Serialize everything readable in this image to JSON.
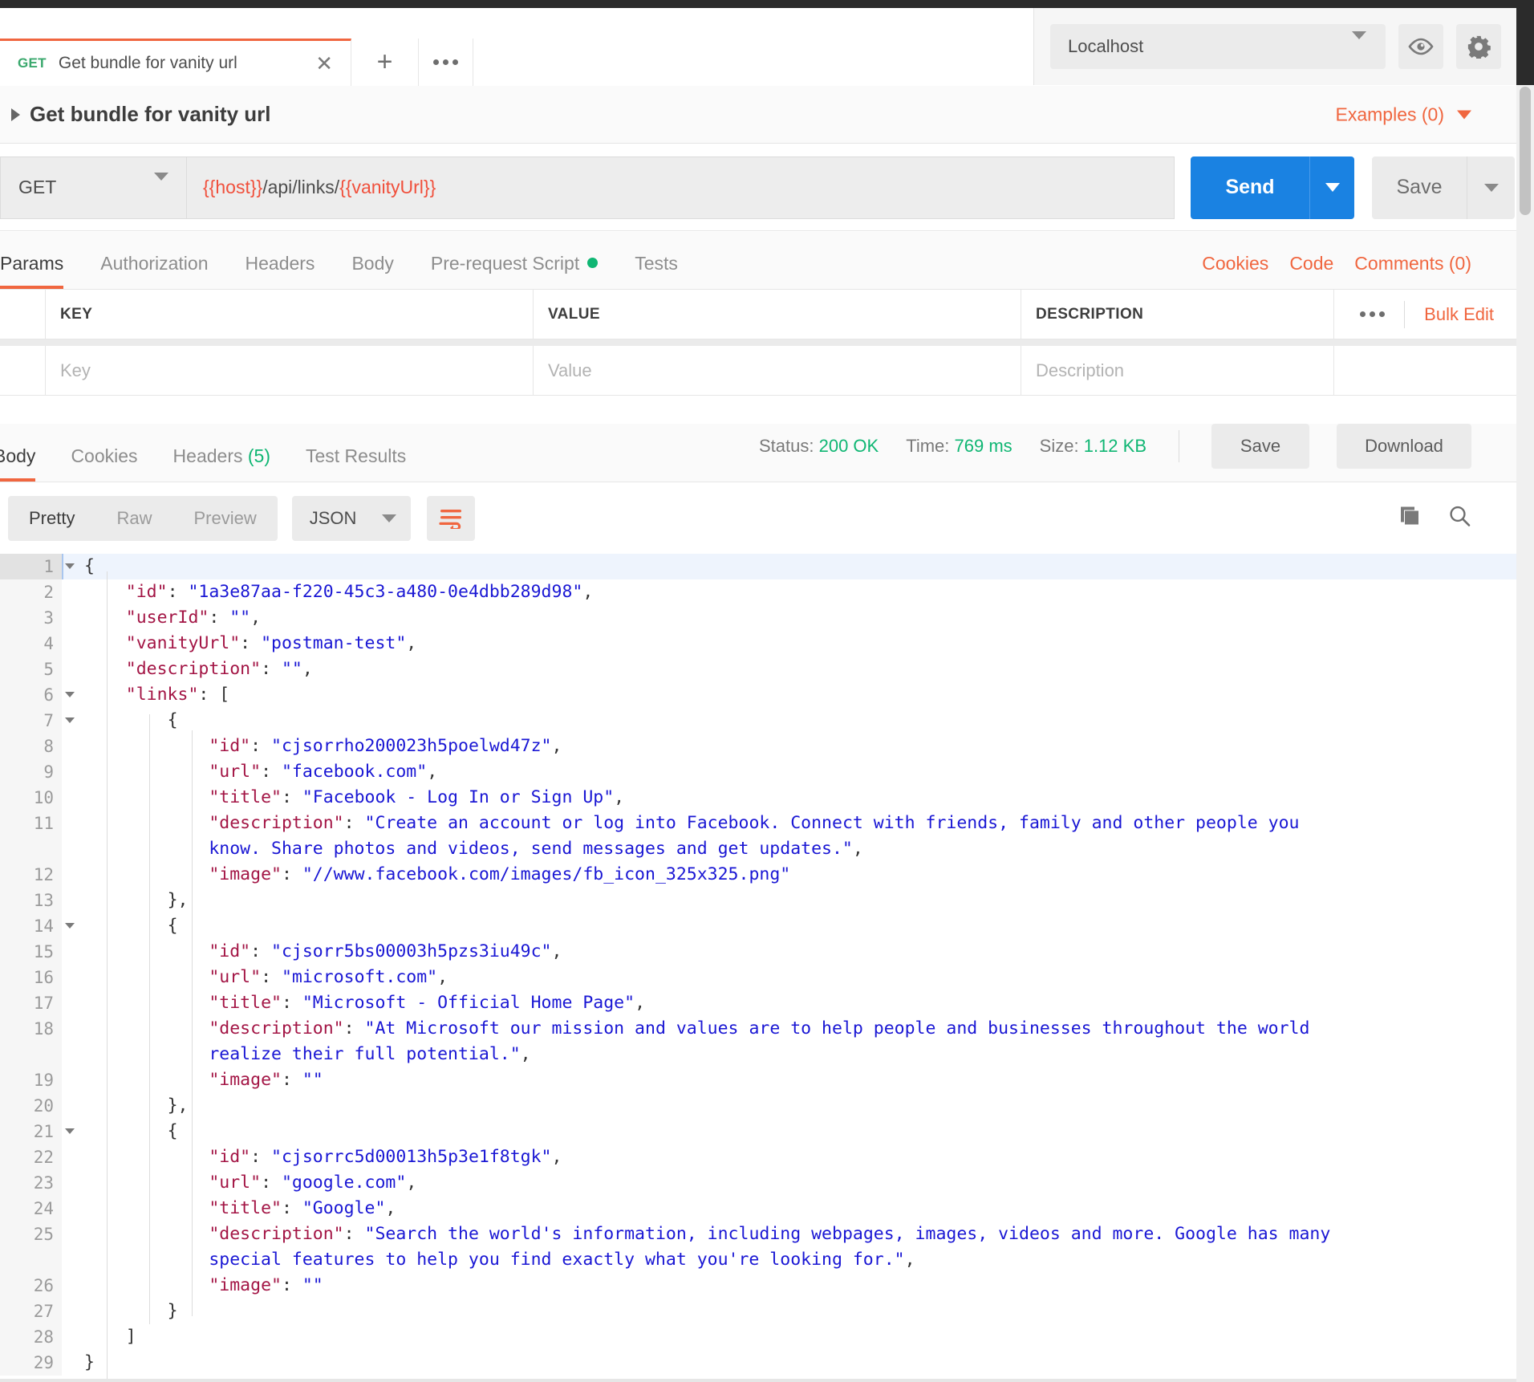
{
  "window": {
    "tab": {
      "method": "GET",
      "title": "Get bundle for vanity url",
      "close_icon": "close-icon",
      "new_tab_icon": "plus-icon",
      "more_icon": "ellipsis-icon"
    },
    "environment": {
      "selected": "Localhost",
      "eye_icon": "eye-icon",
      "gear_icon": "gear-icon"
    }
  },
  "request": {
    "title": "Get bundle for vanity url",
    "examples_label": "Examples (0)",
    "method": "GET",
    "url_parts": [
      {
        "text": "{{host}}",
        "type": "variable"
      },
      {
        "text": "/api/links/",
        "type": "plain"
      },
      {
        "text": "{{vanityUrl}}",
        "type": "variable"
      }
    ],
    "url_full": "{{host}}/api/links/{{vanityUrl}}",
    "send_label": "Send",
    "save_label": "Save",
    "tabs": [
      {
        "label": "Params",
        "active": true,
        "dot": false
      },
      {
        "label": "Authorization",
        "active": false,
        "dot": false
      },
      {
        "label": "Headers",
        "active": false,
        "dot": false
      },
      {
        "label": "Body",
        "active": false,
        "dot": false
      },
      {
        "label": "Pre-request Script",
        "active": false,
        "dot": true
      },
      {
        "label": "Tests",
        "active": false,
        "dot": false
      }
    ],
    "right_links": [
      "Cookies",
      "Code",
      "Comments (0)"
    ]
  },
  "params_table": {
    "headers": [
      "KEY",
      "VALUE",
      "DESCRIPTION"
    ],
    "bulk_edit_label": "Bulk Edit",
    "more_icon": "ellipsis-icon",
    "placeholders": [
      "Key",
      "Value",
      "Description"
    ]
  },
  "response": {
    "tabs": [
      {
        "label": "Body",
        "active": true
      },
      {
        "label": "Cookies",
        "active": false
      },
      {
        "label": "Headers",
        "count": "(5)",
        "active": false
      },
      {
        "label": "Test Results",
        "active": false
      }
    ],
    "status_label": "Status:",
    "status_value": "200 OK",
    "time_label": "Time:",
    "time_value": "769 ms",
    "size_label": "Size:",
    "size_value": "1.12 KB",
    "save_label": "Save",
    "download_label": "Download",
    "view_modes": [
      {
        "label": "Pretty",
        "active": true
      },
      {
        "label": "Raw",
        "active": false
      },
      {
        "label": "Preview",
        "active": false
      }
    ],
    "format": "JSON",
    "wrap_icon": "wrap-lines-icon",
    "copy_icon": "copy-icon",
    "search_icon": "search-icon"
  },
  "body_lines": [
    {
      "n": "1",
      "fold": true,
      "highlight": true,
      "indent": 0,
      "tokens": [
        {
          "t": "{",
          "c": "p"
        }
      ]
    },
    {
      "n": "2",
      "fold": false,
      "highlight": false,
      "indent": 1,
      "tokens": [
        {
          "t": "\"id\"",
          "c": "k"
        },
        {
          "t": ": ",
          "c": "p"
        },
        {
          "t": "\"1a3e87aa-f220-45c3-a480-0e4dbb289d98\"",
          "c": "s"
        },
        {
          "t": ",",
          "c": "p"
        }
      ]
    },
    {
      "n": "3",
      "fold": false,
      "highlight": false,
      "indent": 1,
      "tokens": [
        {
          "t": "\"userId\"",
          "c": "k"
        },
        {
          "t": ": ",
          "c": "p"
        },
        {
          "t": "\"\"",
          "c": "s"
        },
        {
          "t": ",",
          "c": "p"
        }
      ]
    },
    {
      "n": "4",
      "fold": false,
      "highlight": false,
      "indent": 1,
      "tokens": [
        {
          "t": "\"vanityUrl\"",
          "c": "k"
        },
        {
          "t": ": ",
          "c": "p"
        },
        {
          "t": "\"postman-test\"",
          "c": "s"
        },
        {
          "t": ",",
          "c": "p"
        }
      ]
    },
    {
      "n": "5",
      "fold": false,
      "highlight": false,
      "indent": 1,
      "tokens": [
        {
          "t": "\"description\"",
          "c": "k"
        },
        {
          "t": ": ",
          "c": "p"
        },
        {
          "t": "\"\"",
          "c": "s"
        },
        {
          "t": ",",
          "c": "p"
        }
      ]
    },
    {
      "n": "6",
      "fold": true,
      "highlight": false,
      "indent": 1,
      "tokens": [
        {
          "t": "\"links\"",
          "c": "k"
        },
        {
          "t": ": [",
          "c": "p"
        }
      ]
    },
    {
      "n": "7",
      "fold": true,
      "highlight": false,
      "indent": 2,
      "tokens": [
        {
          "t": "{",
          "c": "p"
        }
      ]
    },
    {
      "n": "8",
      "fold": false,
      "highlight": false,
      "indent": 3,
      "tokens": [
        {
          "t": "\"id\"",
          "c": "k"
        },
        {
          "t": ": ",
          "c": "p"
        },
        {
          "t": "\"cjsorrho200023h5poelwd47z\"",
          "c": "s"
        },
        {
          "t": ",",
          "c": "p"
        }
      ]
    },
    {
      "n": "9",
      "fold": false,
      "highlight": false,
      "indent": 3,
      "tokens": [
        {
          "t": "\"url\"",
          "c": "k"
        },
        {
          "t": ": ",
          "c": "p"
        },
        {
          "t": "\"facebook.com\"",
          "c": "s"
        },
        {
          "t": ",",
          "c": "p"
        }
      ]
    },
    {
      "n": "10",
      "fold": false,
      "highlight": false,
      "indent": 3,
      "tokens": [
        {
          "t": "\"title\"",
          "c": "k"
        },
        {
          "t": ": ",
          "c": "p"
        },
        {
          "t": "\"Facebook - Log In or Sign Up\"",
          "c": "s"
        },
        {
          "t": ",",
          "c": "p"
        }
      ]
    },
    {
      "n": "11",
      "fold": false,
      "highlight": false,
      "indent": 3,
      "tokens": [
        {
          "t": "\"description\"",
          "c": "k"
        },
        {
          "t": ": ",
          "c": "p"
        },
        {
          "t": "\"Create an account or log into Facebook. Connect with friends, family and other people you\n            know. Share photos and videos, send messages and get updates.\"",
          "c": "s"
        },
        {
          "t": ",",
          "c": "p"
        }
      ]
    },
    {
      "n": "12",
      "fold": false,
      "highlight": false,
      "indent": 3,
      "tokens": [
        {
          "t": "\"image\"",
          "c": "k"
        },
        {
          "t": ": ",
          "c": "p"
        },
        {
          "t": "\"//www.facebook.com/images/fb_icon_325x325.png\"",
          "c": "s"
        }
      ]
    },
    {
      "n": "13",
      "fold": false,
      "highlight": false,
      "indent": 2,
      "tokens": [
        {
          "t": "},",
          "c": "p"
        }
      ]
    },
    {
      "n": "14",
      "fold": true,
      "highlight": false,
      "indent": 2,
      "tokens": [
        {
          "t": "{",
          "c": "p"
        }
      ]
    },
    {
      "n": "15",
      "fold": false,
      "highlight": false,
      "indent": 3,
      "tokens": [
        {
          "t": "\"id\"",
          "c": "k"
        },
        {
          "t": ": ",
          "c": "p"
        },
        {
          "t": "\"cjsorr5bs00003h5pzs3iu49c\"",
          "c": "s"
        },
        {
          "t": ",",
          "c": "p"
        }
      ]
    },
    {
      "n": "16",
      "fold": false,
      "highlight": false,
      "indent": 3,
      "tokens": [
        {
          "t": "\"url\"",
          "c": "k"
        },
        {
          "t": ": ",
          "c": "p"
        },
        {
          "t": "\"microsoft.com\"",
          "c": "s"
        },
        {
          "t": ",",
          "c": "p"
        }
      ]
    },
    {
      "n": "17",
      "fold": false,
      "highlight": false,
      "indent": 3,
      "tokens": [
        {
          "t": "\"title\"",
          "c": "k"
        },
        {
          "t": ": ",
          "c": "p"
        },
        {
          "t": "\"Microsoft - Official Home Page\"",
          "c": "s"
        },
        {
          "t": ",",
          "c": "p"
        }
      ]
    },
    {
      "n": "18",
      "fold": false,
      "highlight": false,
      "indent": 3,
      "tokens": [
        {
          "t": "\"description\"",
          "c": "k"
        },
        {
          "t": ": ",
          "c": "p"
        },
        {
          "t": "\"At Microsoft our mission and values are to help people and businesses throughout the world\n            realize their full potential.\"",
          "c": "s"
        },
        {
          "t": ",",
          "c": "p"
        }
      ]
    },
    {
      "n": "19",
      "fold": false,
      "highlight": false,
      "indent": 3,
      "tokens": [
        {
          "t": "\"image\"",
          "c": "k"
        },
        {
          "t": ": ",
          "c": "p"
        },
        {
          "t": "\"\"",
          "c": "s"
        }
      ]
    },
    {
      "n": "20",
      "fold": false,
      "highlight": false,
      "indent": 2,
      "tokens": [
        {
          "t": "},",
          "c": "p"
        }
      ]
    },
    {
      "n": "21",
      "fold": true,
      "highlight": false,
      "indent": 2,
      "tokens": [
        {
          "t": "{",
          "c": "p"
        }
      ]
    },
    {
      "n": "22",
      "fold": false,
      "highlight": false,
      "indent": 3,
      "tokens": [
        {
          "t": "\"id\"",
          "c": "k"
        },
        {
          "t": ": ",
          "c": "p"
        },
        {
          "t": "\"cjsorrc5d00013h5p3e1f8tgk\"",
          "c": "s"
        },
        {
          "t": ",",
          "c": "p"
        }
      ]
    },
    {
      "n": "23",
      "fold": false,
      "highlight": false,
      "indent": 3,
      "tokens": [
        {
          "t": "\"url\"",
          "c": "k"
        },
        {
          "t": ": ",
          "c": "p"
        },
        {
          "t": "\"google.com\"",
          "c": "s"
        },
        {
          "t": ",",
          "c": "p"
        }
      ]
    },
    {
      "n": "24",
      "fold": false,
      "highlight": false,
      "indent": 3,
      "tokens": [
        {
          "t": "\"title\"",
          "c": "k"
        },
        {
          "t": ": ",
          "c": "p"
        },
        {
          "t": "\"Google\"",
          "c": "s"
        },
        {
          "t": ",",
          "c": "p"
        }
      ]
    },
    {
      "n": "25",
      "fold": false,
      "highlight": false,
      "indent": 3,
      "tokens": [
        {
          "t": "\"description\"",
          "c": "k"
        },
        {
          "t": ": ",
          "c": "p"
        },
        {
          "t": "\"Search the world's information, including webpages, images, videos and more. Google has many\n            special features to help you find exactly what you're looking for.\"",
          "c": "s"
        },
        {
          "t": ",",
          "c": "p"
        }
      ]
    },
    {
      "n": "26",
      "fold": false,
      "highlight": false,
      "indent": 3,
      "tokens": [
        {
          "t": "\"image\"",
          "c": "k"
        },
        {
          "t": ": ",
          "c": "p"
        },
        {
          "t": "\"\"",
          "c": "s"
        }
      ]
    },
    {
      "n": "27",
      "fold": false,
      "highlight": false,
      "indent": 2,
      "tokens": [
        {
          "t": "}",
          "c": "p"
        }
      ]
    },
    {
      "n": "28",
      "fold": false,
      "highlight": false,
      "indent": 1,
      "tokens": [
        {
          "t": "]",
          "c": "p"
        }
      ]
    },
    {
      "n": "29",
      "fold": false,
      "highlight": false,
      "indent": 0,
      "tokens": [
        {
          "t": "}",
          "c": "p"
        }
      ]
    }
  ]
}
